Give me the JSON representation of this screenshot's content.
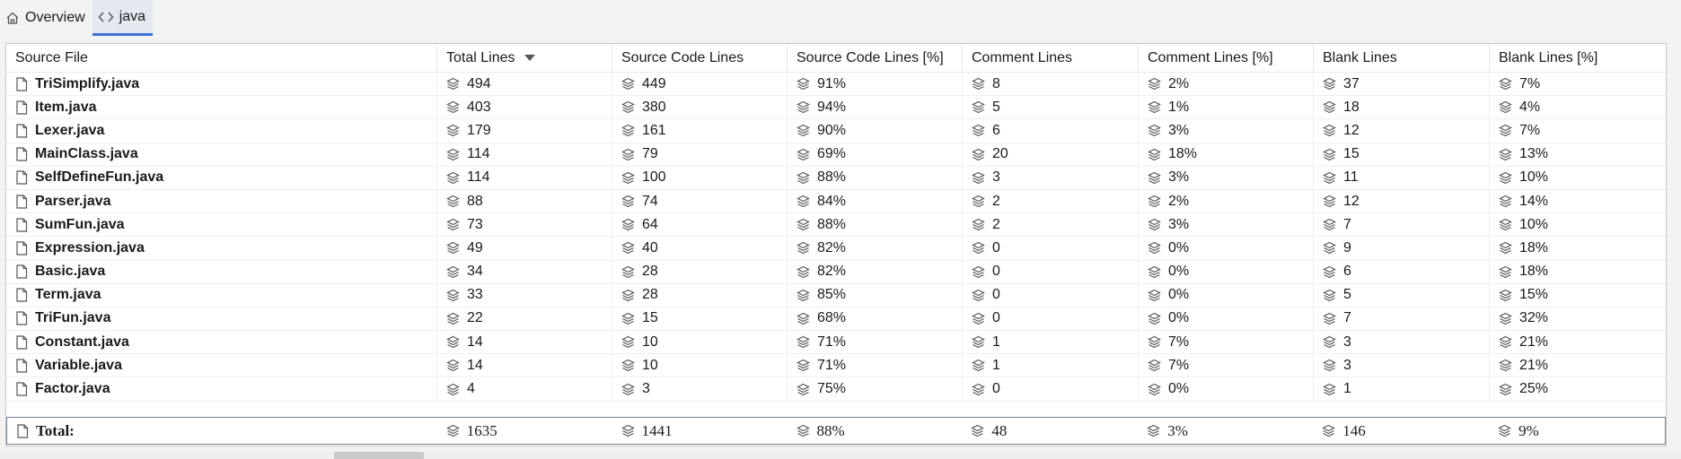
{
  "tabs": [
    {
      "label": "Overview",
      "icon": "home-icon"
    },
    {
      "label": "java",
      "icon": "code-icon",
      "active": true
    }
  ],
  "table": {
    "columns": [
      "Source File",
      "Total Lines",
      "Source Code Lines",
      "Source Code Lines [%]",
      "Comment Lines",
      "Comment Lines [%]",
      "Blank Lines",
      "Blank Lines [%]"
    ],
    "sorted_column": "Total Lines",
    "sort_direction": "descending",
    "rows": [
      [
        "TriSimplify.java",
        "494",
        "449",
        "91%",
        "8",
        "2%",
        "37",
        "7%"
      ],
      [
        "Item.java",
        "403",
        "380",
        "94%",
        "5",
        "1%",
        "18",
        "4%"
      ],
      [
        "Lexer.java",
        "179",
        "161",
        "90%",
        "6",
        "3%",
        "12",
        "7%"
      ],
      [
        "MainClass.java",
        "114",
        "79",
        "69%",
        "20",
        "18%",
        "15",
        "13%"
      ],
      [
        "SelfDefineFun.java",
        "114",
        "100",
        "88%",
        "3",
        "3%",
        "11",
        "10%"
      ],
      [
        "Parser.java",
        "88",
        "74",
        "84%",
        "2",
        "2%",
        "12",
        "14%"
      ],
      [
        "SumFun.java",
        "73",
        "64",
        "88%",
        "2",
        "3%",
        "7",
        "10%"
      ],
      [
        "Expression.java",
        "49",
        "40",
        "82%",
        "0",
        "0%",
        "9",
        "18%"
      ],
      [
        "Basic.java",
        "34",
        "28",
        "82%",
        "0",
        "0%",
        "6",
        "18%"
      ],
      [
        "Term.java",
        "33",
        "28",
        "85%",
        "0",
        "0%",
        "5",
        "15%"
      ],
      [
        "TriFun.java",
        "22",
        "15",
        "68%",
        "0",
        "0%",
        "7",
        "32%"
      ],
      [
        "Constant.java",
        "14",
        "10",
        "71%",
        "1",
        "7%",
        "3",
        "21%"
      ],
      [
        "Variable.java",
        "14",
        "10",
        "71%",
        "1",
        "7%",
        "3",
        "21%"
      ],
      [
        "Factor.java",
        "4",
        "3",
        "75%",
        "0",
        "0%",
        "1",
        "25%"
      ]
    ],
    "total": [
      "Total:",
      "1635",
      "1441",
      "88%",
      "48",
      "3%",
      "146",
      "9%"
    ]
  },
  "icons": {
    "file": "file-icon",
    "metric": "layers-icon"
  }
}
